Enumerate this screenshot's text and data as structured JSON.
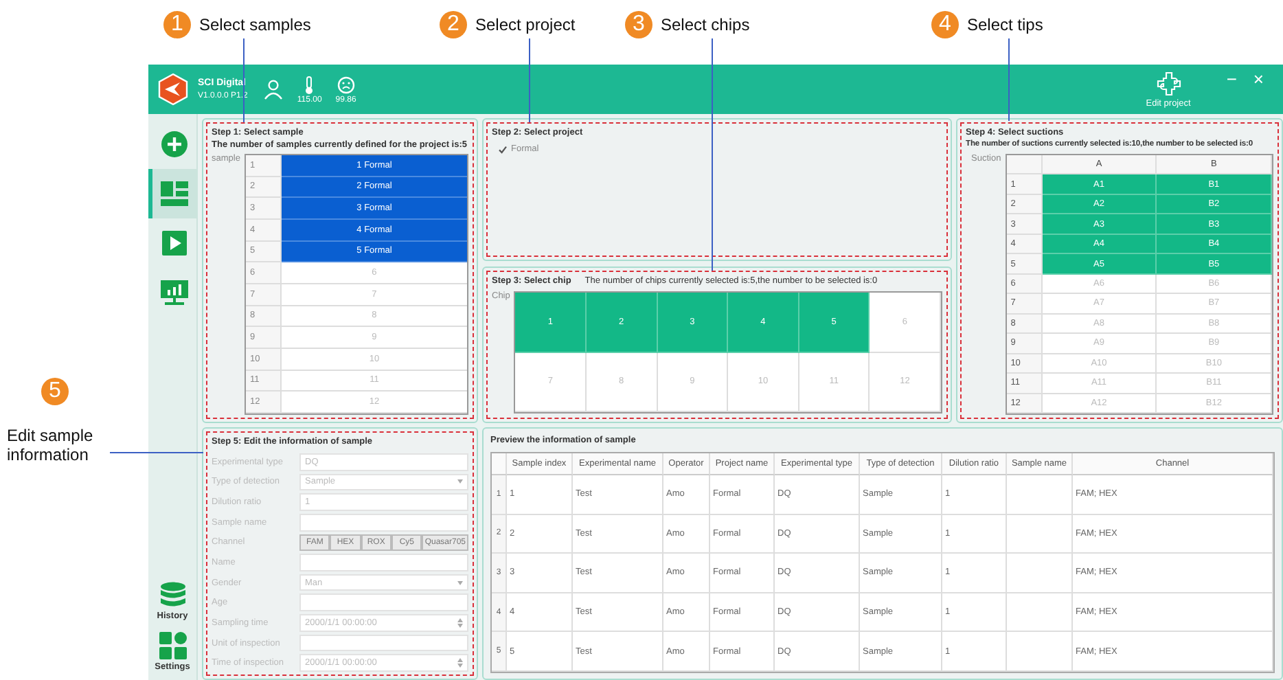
{
  "annotations": [
    {
      "number": "1",
      "label": "Select samples"
    },
    {
      "number": "2",
      "label": "Select project"
    },
    {
      "number": "3",
      "label": "Select chips"
    },
    {
      "number": "4",
      "label": "Select tips"
    },
    {
      "number": "5",
      "label": "Edit sample information"
    }
  ],
  "header": {
    "app_name": "SCI Digital",
    "version": "V1.0.0.0 P1.2",
    "temperature": "115.00",
    "status_reading": "99.86",
    "edit_project": "Edit project",
    "minimize": "−",
    "close": "×"
  },
  "sidebar": {
    "items": [
      {
        "kind": "add",
        "selected": false
      },
      {
        "kind": "layout",
        "selected": true
      },
      {
        "kind": "run",
        "selected": false
      },
      {
        "kind": "analysis",
        "selected": false
      }
    ],
    "bottom": [
      {
        "kind": "history",
        "label": "History"
      },
      {
        "kind": "settings",
        "label": "Settings"
      }
    ]
  },
  "step1": {
    "title": "Step 1: Select sample",
    "count_text": "The number of samples currently defined for the project is:5",
    "axis_label": "sample",
    "rows": [
      {
        "index": "1",
        "label": "1 Formal",
        "selected": true
      },
      {
        "index": "2",
        "label": "2 Formal",
        "selected": true
      },
      {
        "index": "3",
        "label": "3 Formal",
        "selected": true
      },
      {
        "index": "4",
        "label": "4 Formal",
        "selected": true
      },
      {
        "index": "5",
        "label": "5 Formal",
        "selected": true
      },
      {
        "index": "6",
        "label": "6",
        "selected": false
      },
      {
        "index": "7",
        "label": "7",
        "selected": false
      },
      {
        "index": "8",
        "label": "8",
        "selected": false
      },
      {
        "index": "9",
        "label": "9",
        "selected": false
      },
      {
        "index": "10",
        "label": "10",
        "selected": false
      },
      {
        "index": "11",
        "label": "11",
        "selected": false
      },
      {
        "index": "12",
        "label": "12",
        "selected": false
      }
    ]
  },
  "step2": {
    "title": "Step 2: Select project",
    "projects": [
      {
        "name": "Formal",
        "checked": true
      }
    ]
  },
  "step3": {
    "title": "Step 3: Select chip",
    "count_text": "The number of chips currently selected is:5,the number to be selected is:0",
    "axis_label": "Chip",
    "chips": [
      {
        "label": "1",
        "selected": true
      },
      {
        "label": "2",
        "selected": true
      },
      {
        "label": "3",
        "selected": true
      },
      {
        "label": "4",
        "selected": true
      },
      {
        "label": "5",
        "selected": true
      },
      {
        "label": "6",
        "selected": false
      },
      {
        "label": "7",
        "selected": false
      },
      {
        "label": "8",
        "selected": false
      },
      {
        "label": "9",
        "selected": false
      },
      {
        "label": "10",
        "selected": false
      },
      {
        "label": "11",
        "selected": false
      },
      {
        "label": "12",
        "selected": false
      }
    ]
  },
  "step4": {
    "title": "Step 4: Select suctions",
    "count_text": "The number of suctions currently selected is:10,the number to be selected is:0",
    "axis_label": "Suction",
    "columns": [
      "A",
      "B"
    ],
    "rows": [
      {
        "index": "1",
        "cells": [
          {
            "label": "A1",
            "selected": true
          },
          {
            "label": "B1",
            "selected": true
          }
        ]
      },
      {
        "index": "2",
        "cells": [
          {
            "label": "A2",
            "selected": true
          },
          {
            "label": "B2",
            "selected": true
          }
        ]
      },
      {
        "index": "3",
        "cells": [
          {
            "label": "A3",
            "selected": true
          },
          {
            "label": "B3",
            "selected": true
          }
        ]
      },
      {
        "index": "4",
        "cells": [
          {
            "label": "A4",
            "selected": true
          },
          {
            "label": "B4",
            "selected": true
          }
        ]
      },
      {
        "index": "5",
        "cells": [
          {
            "label": "A5",
            "selected": true
          },
          {
            "label": "B5",
            "selected": true
          }
        ]
      },
      {
        "index": "6",
        "cells": [
          {
            "label": "A6",
            "selected": false
          },
          {
            "label": "B6",
            "selected": false
          }
        ]
      },
      {
        "index": "7",
        "cells": [
          {
            "label": "A7",
            "selected": false
          },
          {
            "label": "B7",
            "selected": false
          }
        ]
      },
      {
        "index": "8",
        "cells": [
          {
            "label": "A8",
            "selected": false
          },
          {
            "label": "B8",
            "selected": false
          }
        ]
      },
      {
        "index": "9",
        "cells": [
          {
            "label": "A9",
            "selected": false
          },
          {
            "label": "B9",
            "selected": false
          }
        ]
      },
      {
        "index": "10",
        "cells": [
          {
            "label": "A10",
            "selected": false
          },
          {
            "label": "B10",
            "selected": false
          }
        ]
      },
      {
        "index": "11",
        "cells": [
          {
            "label": "A11",
            "selected": false
          },
          {
            "label": "B11",
            "selected": false
          }
        ]
      },
      {
        "index": "12",
        "cells": [
          {
            "label": "A12",
            "selected": false
          },
          {
            "label": "B12",
            "selected": false
          }
        ]
      }
    ]
  },
  "step5": {
    "title": "Step 5: Edit the information of sample",
    "fields": [
      {
        "kind": "text",
        "label": "Experimental type",
        "value": "DQ",
        "disabled": true
      },
      {
        "kind": "select",
        "label": "Type of detection",
        "value": "Sample",
        "disabled": true
      },
      {
        "kind": "text",
        "label": "Dilution ratio",
        "value": "1",
        "disabled": true
      },
      {
        "kind": "text",
        "label": "Sample name",
        "disabled": true
      },
      {
        "kind": "channels",
        "label": "Channel",
        "options": [
          "FAM",
          "HEX",
          "ROX",
          "Cy5",
          "Quasar705"
        ],
        "disabled": true
      },
      {
        "kind": "text",
        "label": "Name",
        "disabled": true
      },
      {
        "kind": "select",
        "label": "Gender",
        "value": "Man",
        "disabled": true
      },
      {
        "kind": "text",
        "label": "Age",
        "disabled": true
      },
      {
        "kind": "spin",
        "label": "Sampling time",
        "value": "2000/1/1 00:00:00",
        "disabled": true
      },
      {
        "kind": "text",
        "label": "Unit of inspection",
        "disabled": true
      },
      {
        "kind": "spin",
        "label": "Time of inspection",
        "value": "2000/1/1 00:00:00",
        "disabled": true
      }
    ]
  },
  "preview": {
    "title": "Preview the information of sample",
    "columns": [
      "Sample index",
      "Experimental name",
      "Operator",
      "Project name",
      "Experimental type",
      "Type of detection",
      "Dilution ratio",
      "Sample name",
      "Channel"
    ],
    "rows": [
      {
        "number": "1",
        "sample_index": "1",
        "experimental_name": "Test",
        "operator": "Amo",
        "project_name": "Formal",
        "experimental_type": "DQ",
        "type_of_detection": "Sample",
        "dilution_ratio": "1",
        "channel": "FAM; HEX"
      },
      {
        "number": "2",
        "sample_index": "2",
        "experimental_name": "Test",
        "operator": "Amo",
        "project_name": "Formal",
        "experimental_type": "DQ",
        "type_of_detection": "Sample",
        "dilution_ratio": "1",
        "channel": "FAM; HEX"
      },
      {
        "number": "3",
        "sample_index": "3",
        "experimental_name": "Test",
        "operator": "Amo",
        "project_name": "Formal",
        "experimental_type": "DQ",
        "type_of_detection": "Sample",
        "dilution_ratio": "1",
        "channel": "FAM; HEX"
      },
      {
        "number": "4",
        "sample_index": "4",
        "experimental_name": "Test",
        "operator": "Amo",
        "project_name": "Formal",
        "experimental_type": "DQ",
        "type_of_detection": "Sample",
        "dilution_ratio": "1",
        "channel": "FAM; HEX"
      },
      {
        "number": "5",
        "sample_index": "5",
        "experimental_name": "Test",
        "operator": "Amo",
        "project_name": "Formal",
        "experimental_type": "DQ",
        "type_of_detection": "Sample",
        "dilution_ratio": "1",
        "channel": "FAM; HEX"
      }
    ]
  }
}
